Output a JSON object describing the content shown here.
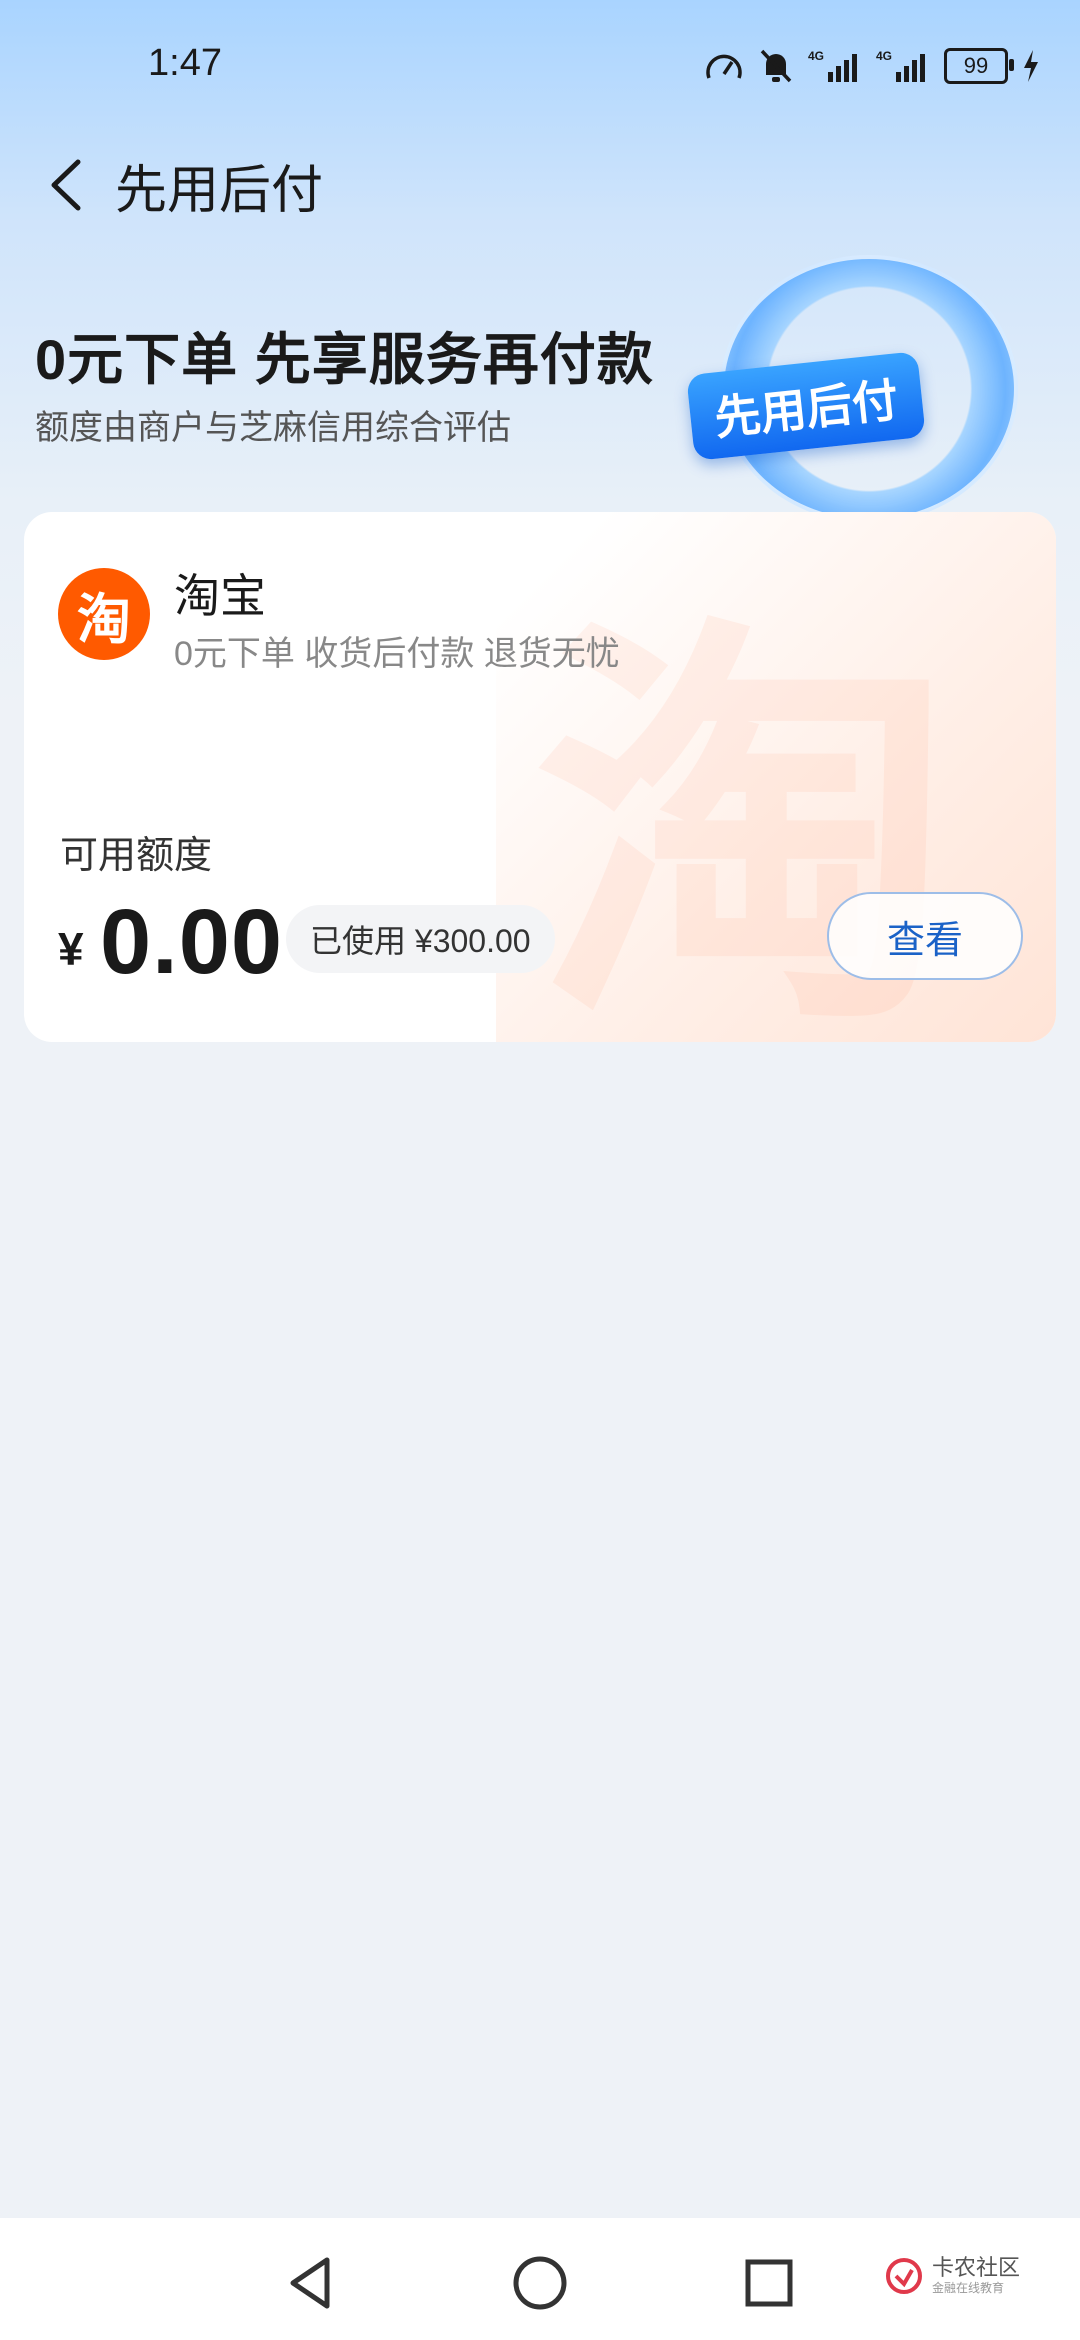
{
  "status_bar": {
    "time": "1:47",
    "battery": "99"
  },
  "nav": {
    "title": "先用后付"
  },
  "hero": {
    "title": "0元下单 先享服务再付款",
    "subtitle": "额度由商户与芝麻信用综合评估",
    "badge": "先用后付"
  },
  "card": {
    "merchant_name": "淘宝",
    "merchant_logo_char": "淘",
    "merchant_desc": "0元下单 收货后付款 退货无忧",
    "watermark_char": "淘",
    "quota_label": "可用额度",
    "currency": "¥",
    "amount": "0.00",
    "used_label": "已使用 ¥300.00",
    "view_button": "查看"
  },
  "watermark": {
    "name": "卡农社区",
    "sub": "金融在线教育"
  },
  "colors": {
    "accent": "#1b62c7",
    "merchant": "#ff5a00"
  }
}
